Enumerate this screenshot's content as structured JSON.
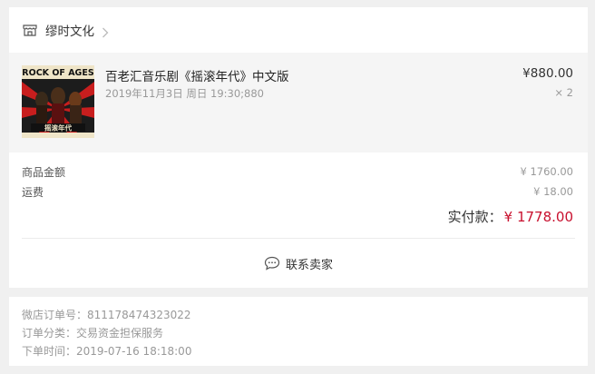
{
  "shop": {
    "name": "缪时文化",
    "icon": "shop-icon"
  },
  "product": {
    "poster_text": "ROCK OF AGES",
    "poster_cn": "摇滚年代",
    "title": "百老汇音乐剧《摇滚年代》中文版",
    "sku": "2019年11月3日 周日 19:30;880",
    "price": "¥880.00",
    "qty": "× 2"
  },
  "summary": {
    "goods_label": "商品金额",
    "goods_value": "¥ 1760.00",
    "shipping_label": "运费",
    "shipping_value": "¥ 18.00",
    "paid_label": "实付款：",
    "paid_value": "¥ 1778.00"
  },
  "contact": {
    "label": "联系卖家",
    "icon": "chat-icon"
  },
  "order_info": {
    "order_no": "微店订单号：811178474323022",
    "category": "订单分类：交易资金担保服务",
    "time": "下单时间：2019-07-16 18:18:00"
  },
  "colors": {
    "accent_red": "#c8102e",
    "muted": "#999999",
    "product_bg": "#f5f5f5"
  }
}
